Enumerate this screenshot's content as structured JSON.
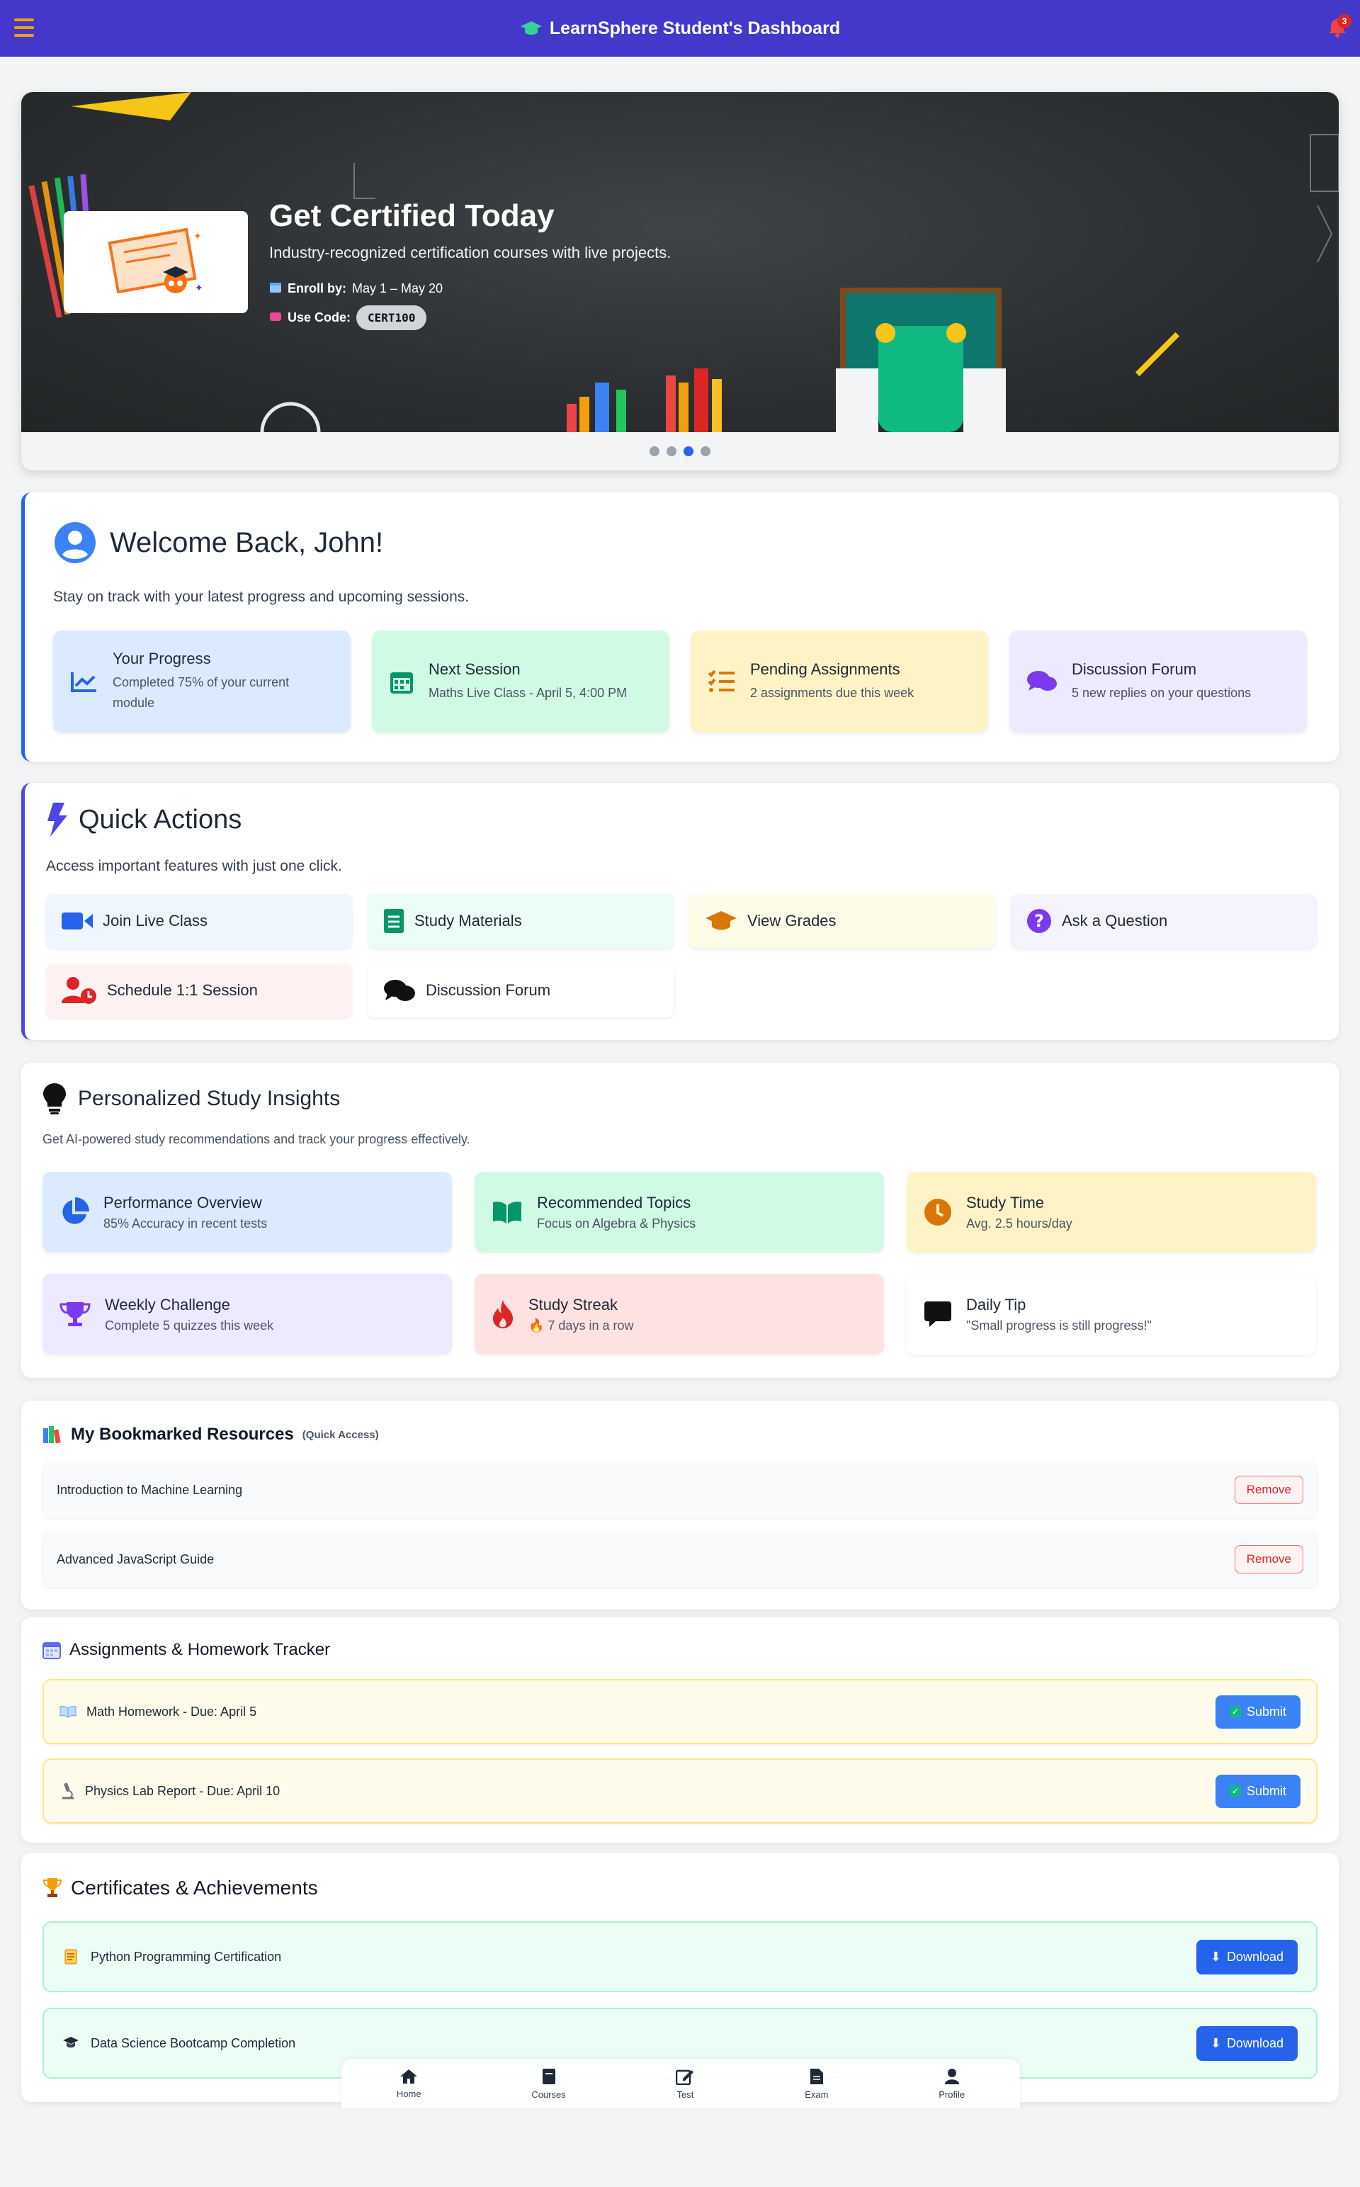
{
  "header": {
    "title": "LearnSphere Student's Dashboard",
    "notification_count": "3"
  },
  "hero": {
    "title": "Get Certified Today",
    "subtitle": "Industry-recognized certification courses with live projects.",
    "enroll_label": "Enroll by:",
    "enroll_value": "May 1 – May 20",
    "code_label": "Use Code:",
    "code_value": "CERT100",
    "slides_total": 4,
    "active_slide": 3
  },
  "welcome": {
    "title": "Welcome Back, John!",
    "subtitle": "Stay on track with your latest progress and upcoming sessions.",
    "tiles": [
      {
        "title": "Your Progress",
        "desc": "Completed 75% of your current module",
        "icon": "chart-line-icon",
        "color": "#dbeafe"
      },
      {
        "title": "Next Session",
        "desc": "Maths Live Class - April 5, 4:00 PM",
        "icon": "calendar-icon",
        "color": "#d1fae5"
      },
      {
        "title": "Pending Assignments",
        "desc": "2 assignments due this week",
        "icon": "task-list-icon",
        "color": "#fef3c7"
      },
      {
        "title": "Discussion Forum",
        "desc": "5 new replies on your questions",
        "icon": "comments-icon",
        "color": "#ede9fe"
      }
    ]
  },
  "quick_actions": {
    "title": "Quick Actions",
    "subtitle": "Access important features with just one click.",
    "buttons": [
      {
        "label": "Join Live Class",
        "icon": "video-icon",
        "color": "#eff6ff"
      },
      {
        "label": "Study Materials",
        "icon": "book-icon",
        "color": "#ecfdf5"
      },
      {
        "label": "View Grades",
        "icon": "graduation-cap-icon",
        "color": "#fefce8"
      },
      {
        "label": "Ask a Question",
        "icon": "question-icon",
        "color": "#f5f3ff"
      },
      {
        "label": "Schedule 1:1 Session",
        "icon": "user-clock-icon",
        "color": "#fef2f2"
      },
      {
        "label": "Discussion Forum",
        "icon": "comments-icon",
        "color": "#ffffff"
      }
    ]
  },
  "insights": {
    "title": "Personalized Study Insights",
    "subtitle": "Get AI-powered study recommendations and track your progress effectively.",
    "tiles": [
      {
        "title": "Performance Overview",
        "desc": "85% Accuracy in recent tests",
        "icon": "pie-chart-icon",
        "color": "#dbeafe"
      },
      {
        "title": "Recommended Topics",
        "desc": "Focus on Algebra & Physics",
        "icon": "open-book-icon",
        "color": "#d1fae5"
      },
      {
        "title": "Study Time",
        "desc": "Avg. 2.5 hours/day",
        "icon": "clock-icon",
        "color": "#fef3c7"
      },
      {
        "title": "Weekly Challenge",
        "desc": "Complete 5 quizzes this week",
        "icon": "trophy-icon",
        "color": "#ede9fe"
      },
      {
        "title": "Study Streak",
        "desc": "🔥 7 days in a row",
        "icon": "fire-icon",
        "color": "#fee2e2"
      },
      {
        "title": "Daily Tip",
        "desc": "\"Small progress is still progress!\"",
        "icon": "comment-icon",
        "color": "#ffffff"
      }
    ]
  },
  "bookmarks": {
    "title": "My Bookmarked Resources",
    "tag": "(Quick Access)",
    "remove_label": "Remove",
    "items": [
      "Introduction to Machine Learning",
      "Advanced JavaScript Guide"
    ]
  },
  "assignments": {
    "title": "Assignments & Homework Tracker",
    "submit_label": "Submit",
    "items": [
      {
        "label": "Math Homework -  Due: April 5",
        "icon": "book-emoji-icon"
      },
      {
        "label": "Physics Lab Report -  Due: April 10",
        "icon": "microscope-icon"
      }
    ]
  },
  "certificates": {
    "title": "Certificates & Achievements",
    "download_label": "Download",
    "items": [
      {
        "label": "Python Programming Certification",
        "icon": "scroll-icon"
      },
      {
        "label": "Data Science Bootcamp Completion",
        "icon": "grad-cap-emoji-icon"
      }
    ]
  },
  "bottom_nav": [
    "Home",
    "Courses",
    "Test",
    "Exam",
    "Profile"
  ]
}
